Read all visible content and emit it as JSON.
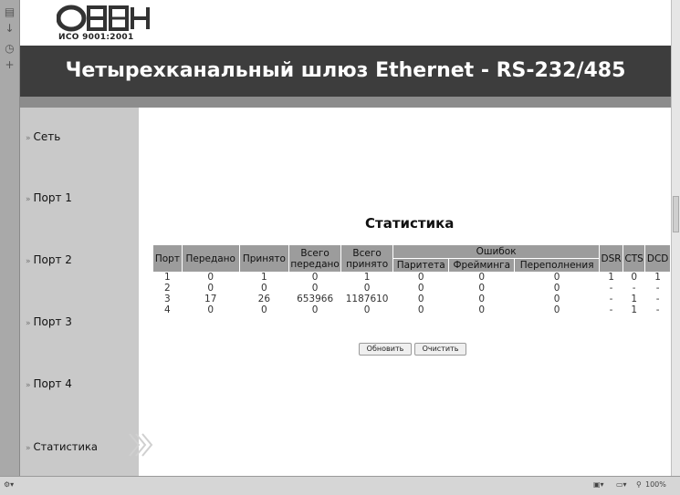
{
  "header": {
    "logo_text": "ОВЕН",
    "logo_iso": "ИСО 9001:2001",
    "title": "Четырехканальный шлюз Ethernet - RS-232/485"
  },
  "menu": {
    "items": [
      {
        "label": "Сеть"
      },
      {
        "label": "Порт 1"
      },
      {
        "label": "Порт 2"
      },
      {
        "label": "Порт 3"
      },
      {
        "label": "Порт 4"
      },
      {
        "label": "Статистика"
      }
    ],
    "active": "Статистика"
  },
  "stats": {
    "title": "Статистика",
    "headers": {
      "port": "Порт",
      "sent": "Передано",
      "received": "Принято",
      "total_sent": "Всего переданo",
      "total_received": "Всего принято",
      "errors": "Ошибок",
      "parity": "Паритета",
      "framing": "Фрейминга",
      "overflow": "Переполнения",
      "dsr": "DSR",
      "cts": "CTS",
      "dcd": "DCD"
    },
    "rows": [
      [
        "1",
        "0",
        "1",
        "0",
        "1",
        "0",
        "0",
        "0",
        "1",
        "0",
        "1"
      ],
      [
        "2",
        "0",
        "0",
        "0",
        "0",
        "0",
        "0",
        "0",
        "-",
        "-",
        "-"
      ],
      [
        "3",
        "17",
        "26",
        "653966",
        "1187610",
        "0",
        "0",
        "0",
        "-",
        "1",
        "-"
      ],
      [
        "4",
        "0",
        "0",
        "0",
        "0",
        "0",
        "0",
        "0",
        "-",
        "1",
        "-"
      ]
    ]
  },
  "buttons": {
    "refresh": "Обновить",
    "clear": "Очистить"
  },
  "statusbar": {
    "zoom": "100%"
  }
}
